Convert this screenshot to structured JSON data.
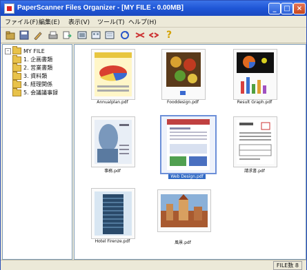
{
  "window": {
    "title": "PaperScanner Files Organizer - [MY FILE - 0.00MB]",
    "controls": [
      "minimize",
      "maximize",
      "close"
    ]
  },
  "menu": {
    "items": [
      "ファイル(F)",
      "編集(E)",
      "表示(V)",
      "ツール(T)",
      "ヘルプ(H)"
    ]
  },
  "toolbar": {
    "buttons": [
      "open-icon",
      "save-icon",
      "edit-icon",
      "scan-icon",
      "export-icon",
      "view-large-icon",
      "view-medium-icon",
      "view-small-icon",
      "refresh-icon",
      "merge-icon",
      "split-icon",
      "help-icon"
    ]
  },
  "tree": {
    "root": "MY FILE",
    "children": [
      "1. 企画書類",
      "2. 営業書類",
      "3. 資料類",
      "4. 経理関係",
      "5. 会議議事録"
    ]
  },
  "files": [
    {
      "name": "Annualplan.pdf",
      "kind": "pie-chart-doc"
    },
    {
      "name": "Fooddesign.pdf",
      "kind": "food-photo"
    },
    {
      "name": "Result Graph.pdf",
      "kind": "graph-doc"
    },
    {
      "name": "事務.pdf",
      "kind": "brochure"
    },
    {
      "name": "Web Design.pdf",
      "kind": "web-page",
      "selected": true
    },
    {
      "name": "請求書.pdf",
      "kind": "invoice"
    },
    {
      "name": "Hotel Firenze.pdf",
      "kind": "building"
    },
    {
      "name": "風景.pdf",
      "kind": "city-photo"
    }
  ],
  "status": {
    "text": "FILE数 8"
  }
}
